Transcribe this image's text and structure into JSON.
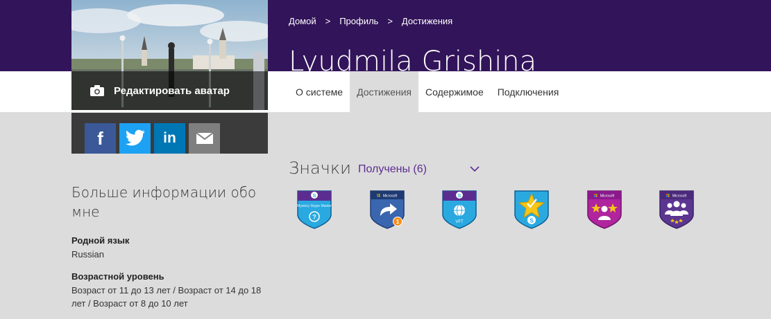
{
  "header": {
    "breadcrumb": [
      {
        "label": "Домой"
      },
      {
        "label": "Профиль"
      },
      {
        "label": "Достижения"
      }
    ],
    "separator": ">",
    "user_name": "Lyudmila Grishina"
  },
  "avatar": {
    "edit_label": "Редактировать аватар"
  },
  "share": [
    {
      "name": "facebook",
      "color": "#3b5998",
      "glyph": "f"
    },
    {
      "name": "twitter",
      "color": "#1da1f2"
    },
    {
      "name": "linkedin",
      "color": "#0077b5",
      "glyph": "in"
    },
    {
      "name": "email",
      "color": "#7f7f7f"
    }
  ],
  "tabs": [
    {
      "label": "О системе",
      "active": false
    },
    {
      "label": "Достижения",
      "active": true
    },
    {
      "label": "Содержимое",
      "active": false
    },
    {
      "label": "Подключения",
      "active": false
    }
  ],
  "about": {
    "title": "Больше информации обо мне",
    "native_language_label": "Родной язык",
    "native_language_value": "Russian",
    "age_level_label": "Возрастной уровень",
    "age_level_value": "Возраст от 11 до 13 лет / Возраст от 14 до 18 лет / Возраст от 8 до 10 лет"
  },
  "badges": {
    "title": "Значки",
    "filter_label": "Получены (6)",
    "items": [
      {
        "name": "mystery-skype-master",
        "label": "Mystery Skype Master",
        "top": "#5c2d91",
        "body": "#2aa9e0",
        "icon": "question-icon"
      },
      {
        "name": "microsoft-share",
        "label": "Microsoft",
        "top": "#1f3a72",
        "body": "#3a66b0",
        "icon": "share-arrow-icon",
        "count": "1"
      },
      {
        "name": "skype-vft",
        "label": "VFT",
        "top": "#5c2d91",
        "body": "#2aa9e0",
        "icon": "globe-icon"
      },
      {
        "name": "skype-star",
        "label": "",
        "top": "#1e8fd6",
        "body": "#2aa9e0",
        "icon": "star-icon"
      },
      {
        "name": "microsoft-community",
        "label": "Microsoft",
        "top": "#8a1a8c",
        "body": "#b0249e",
        "icon": "people-stars-icon"
      },
      {
        "name": "microsoft-group",
        "label": "Microsoft",
        "top": "#4b2a7d",
        "body": "#5b3691",
        "icon": "group-icon"
      }
    ]
  },
  "colors": {
    "brand_purple": "#32145a",
    "accent_purple": "#5c2d91",
    "page_grey": "#dcdcdc"
  }
}
